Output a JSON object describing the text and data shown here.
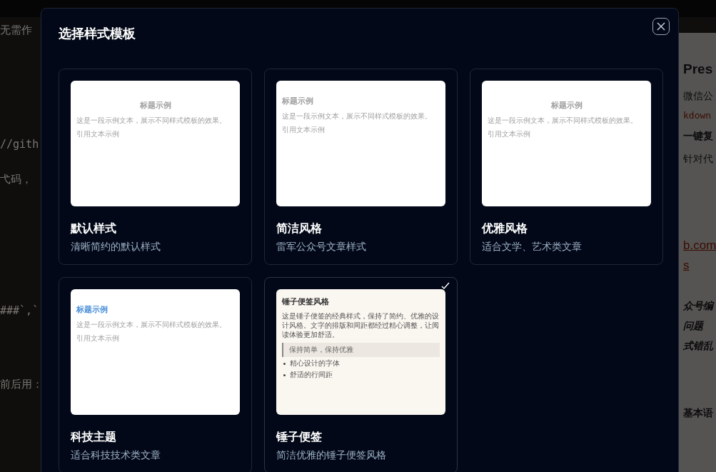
{
  "editor": {
    "lines": [
      {
        "text": "无需作",
        "kind": "text"
      },
      {
        "text": "//gith",
        "kind": "code"
      },
      {
        "text": "弋码，",
        "kind": "text"
      },
      {
        "text": "###`,`",
        "kind": "code"
      },
      {
        "text": "前后用：",
        "kind": "text"
      }
    ]
  },
  "preview": {
    "lines": [
      {
        "text": "Pres",
        "kind": "heading"
      },
      {
        "text": "微信公",
        "kind": "text"
      },
      {
        "text": "kdown",
        "kind": "code"
      },
      {
        "text": "一键复",
        "kind": "strong"
      },
      {
        "text": "针对代",
        "kind": "text"
      },
      {
        "text": "b.com",
        "kind": "link"
      },
      {
        "text": "s",
        "kind": "link"
      },
      {
        "text": "众号编",
        "kind": "quote"
      },
      {
        "text": "问题",
        "kind": "quote"
      },
      {
        "text": "式错乱",
        "kind": "quote"
      },
      {
        "text": "基本语",
        "kind": "heading2"
      }
    ]
  },
  "dialog": {
    "title": "选择样式模板",
    "templates": [
      {
        "name": "默认样式",
        "description": "清晰简约的默认样式",
        "selected": false,
        "kind": "centered",
        "sample": {
          "title": "标题示例",
          "body": "这是一段示例文本，展示不同样式模板的效果。",
          "quote": "引用文本示例"
        }
      },
      {
        "name": "简洁风格",
        "description": "雷军公众号文章样式",
        "selected": false,
        "kind": "plain",
        "sample": {
          "title": "标题示例",
          "body": "这是一段示例文本，展示不同样式模板的效果。",
          "quote": "引用文本示例"
        }
      },
      {
        "name": "优雅风格",
        "description": "适合文学、艺术类文章",
        "selected": false,
        "kind": "centered",
        "sample": {
          "title": "标题示例",
          "body": "这是一段示例文本，展示不同样式模板的效果。",
          "quote": "引用文本示例"
        }
      },
      {
        "name": "科技主题",
        "description": "适合科技技术类文章",
        "selected": false,
        "kind": "tech",
        "sample": {
          "title": "标题示例",
          "body": "这是一段示例文本，展示不同样式模板的效果。",
          "quote": "引用文本示例"
        }
      },
      {
        "name": "锤子便签",
        "description": "简洁优雅的锤子便签风格",
        "selected": true,
        "kind": "note",
        "sample": {
          "title": "锤子便签风格",
          "body": "这是锤子便签的经典样式，保持了简约、优雅的设计风格。文字的排版和间距都经过精心调整，让阅读体验更加舒适。",
          "quote": "保持简单，保持优雅",
          "items": [
            "精心设计的字体",
            "舒适的行间距"
          ]
        }
      }
    ]
  }
}
